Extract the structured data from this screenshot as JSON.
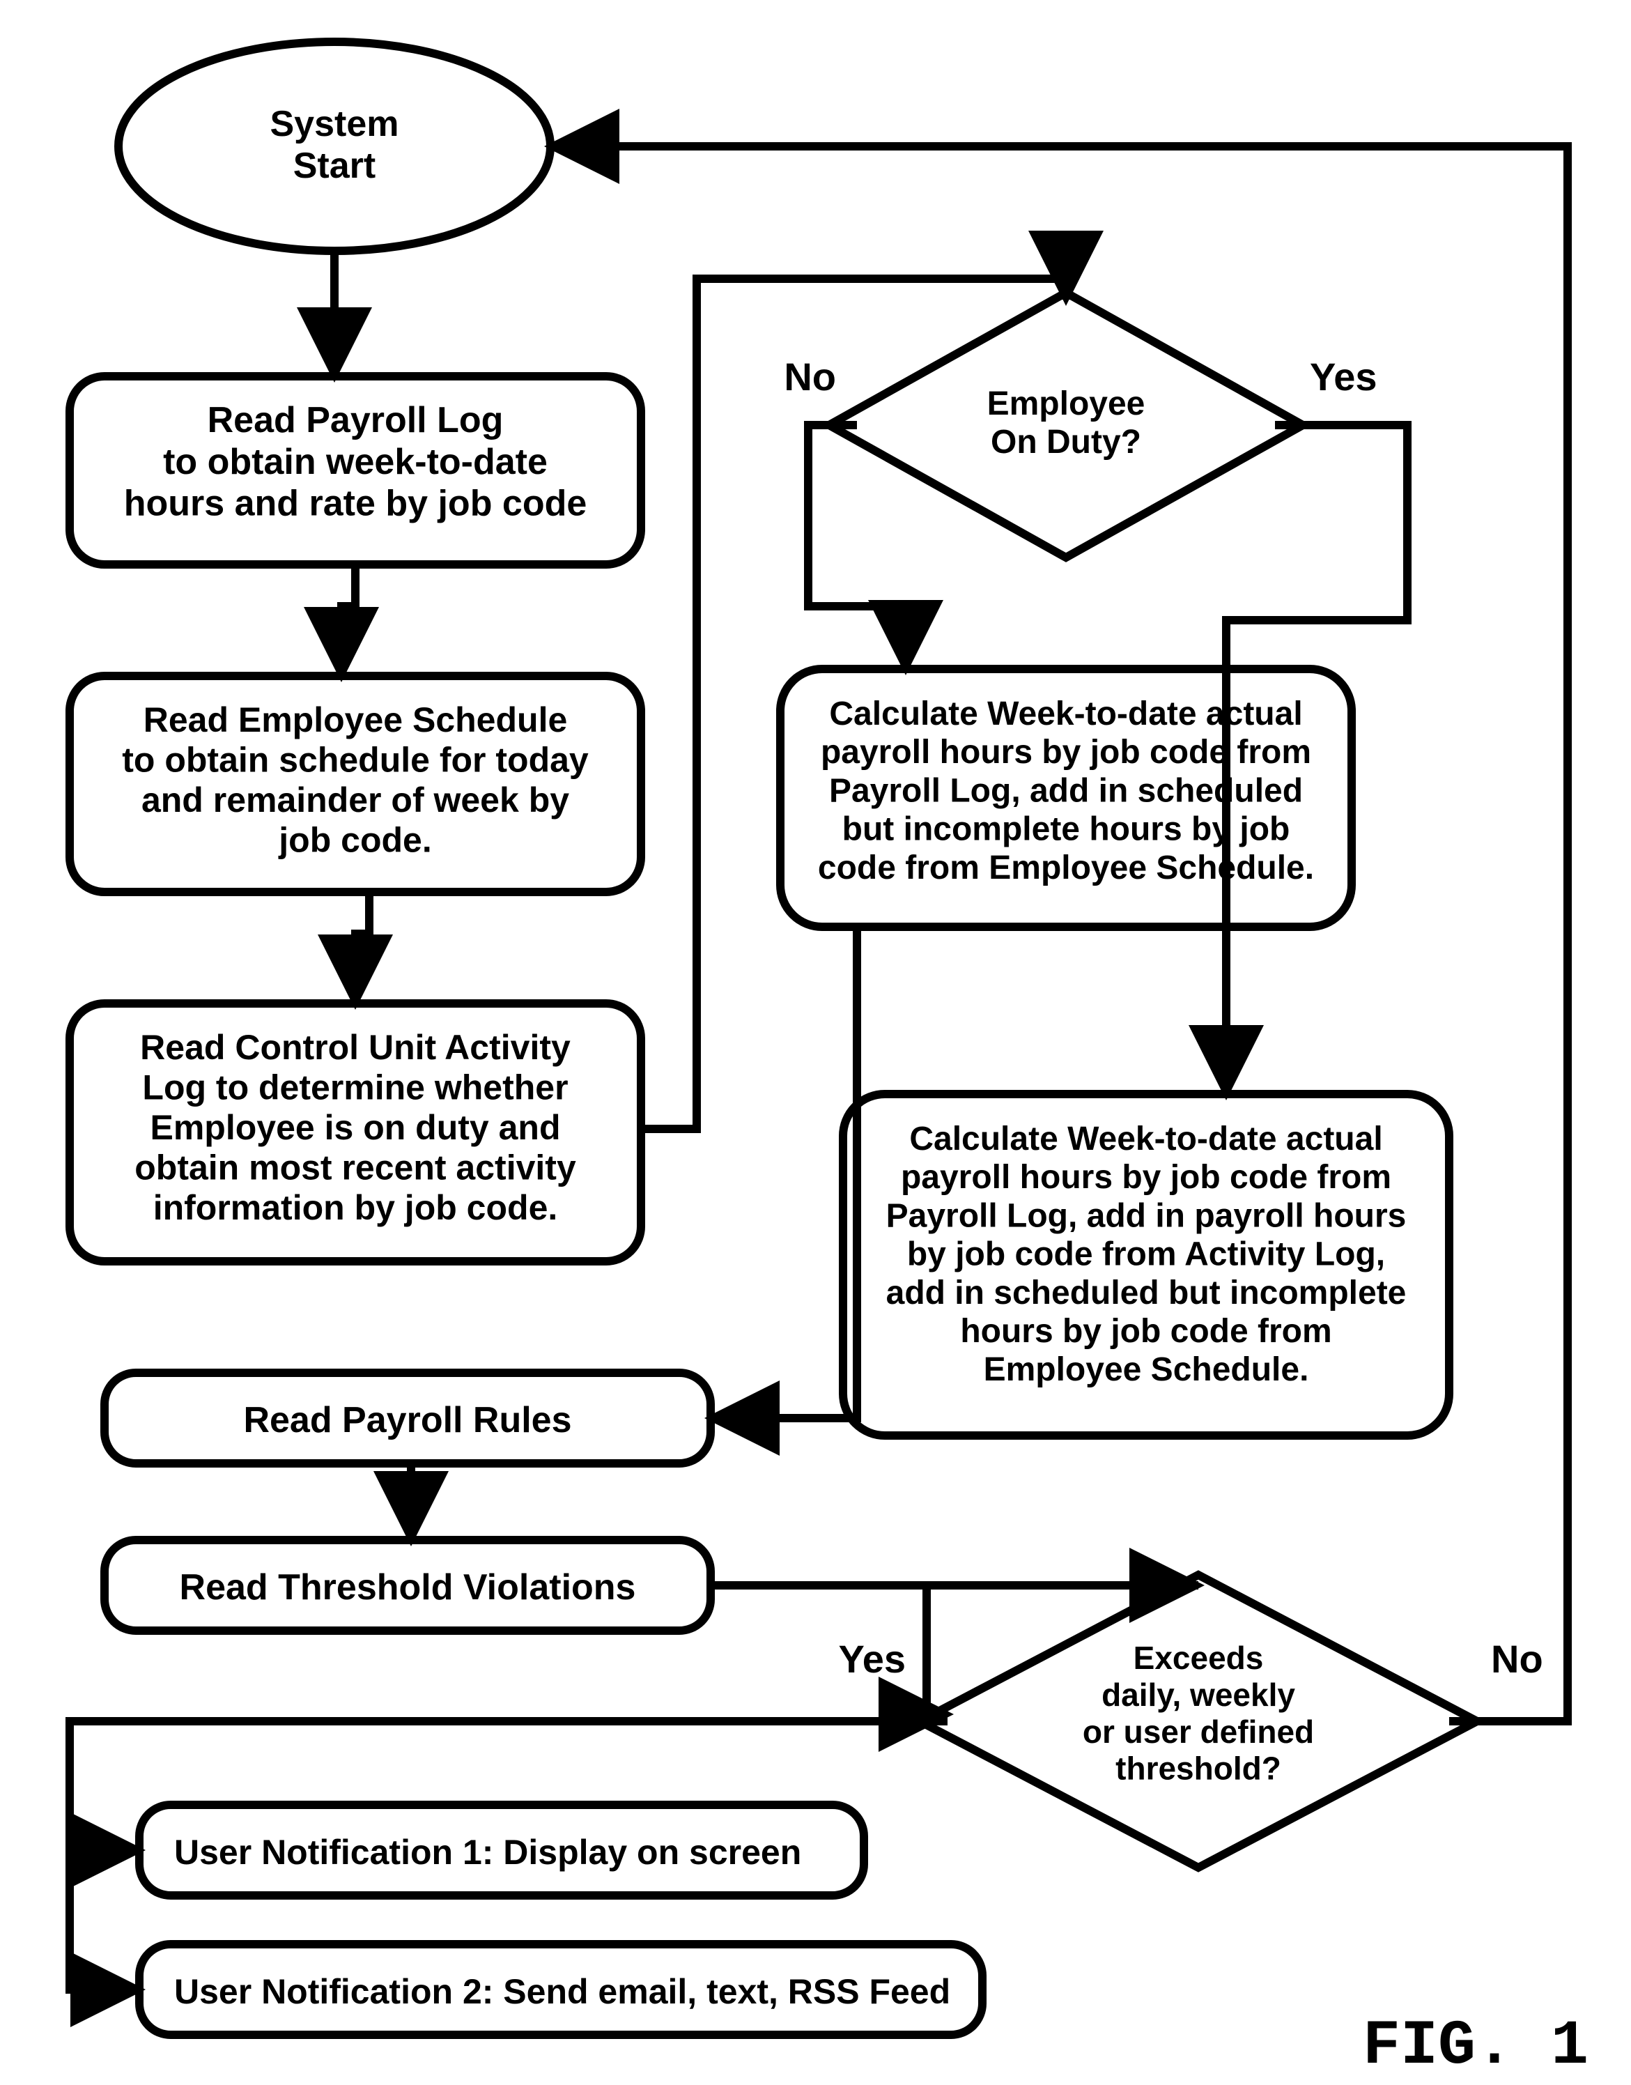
{
  "nodes": {
    "start": {
      "text": "System\nStart"
    },
    "readPayroll": {
      "text": "Read Payroll Log\nto obtain week-to-date\nhours and rate by job code"
    },
    "readSchedule": {
      "text": "Read Employee Schedule\nto obtain schedule for today\nand remainder of week by\njob code."
    },
    "readActivity": {
      "text": "Read Control Unit Activity\nLog to determine whether\nEmployee is on duty and\nobtain most recent activity\ninformation by job code."
    },
    "onDuty": {
      "text": "Employee\nOn Duty?"
    },
    "calcNo": {
      "text": "Calculate Week-to-date actual\npayroll hours by job code from\nPayroll Log, add in scheduled\nbut incomplete hours by job\ncode from Employee Schedule."
    },
    "calcYes": {
      "text": "Calculate Week-to-date actual\npayroll hours by job code from\nPayroll Log, add in payroll hours\nby job code from Activity Log,\nadd in scheduled but incomplete\nhours by job code from\nEmployee Schedule."
    },
    "readRules": {
      "text": "Read Payroll Rules"
    },
    "readThresh": {
      "text": "Read Threshold Violations"
    },
    "exceeds": {
      "text": "Exceeds\ndaily, weekly\nor user defined\nthreshold?"
    },
    "notify1": {
      "text": "User Notification 1: Display on screen"
    },
    "notify2": {
      "text": "User Notification 2: Send email, text, RSS Feed"
    }
  },
  "edgeLabels": {
    "onDutyNo": "No",
    "onDutyYes": "Yes",
    "exceedsYes": "Yes",
    "exceedsNo": "No"
  },
  "figure": "FIG. 1"
}
